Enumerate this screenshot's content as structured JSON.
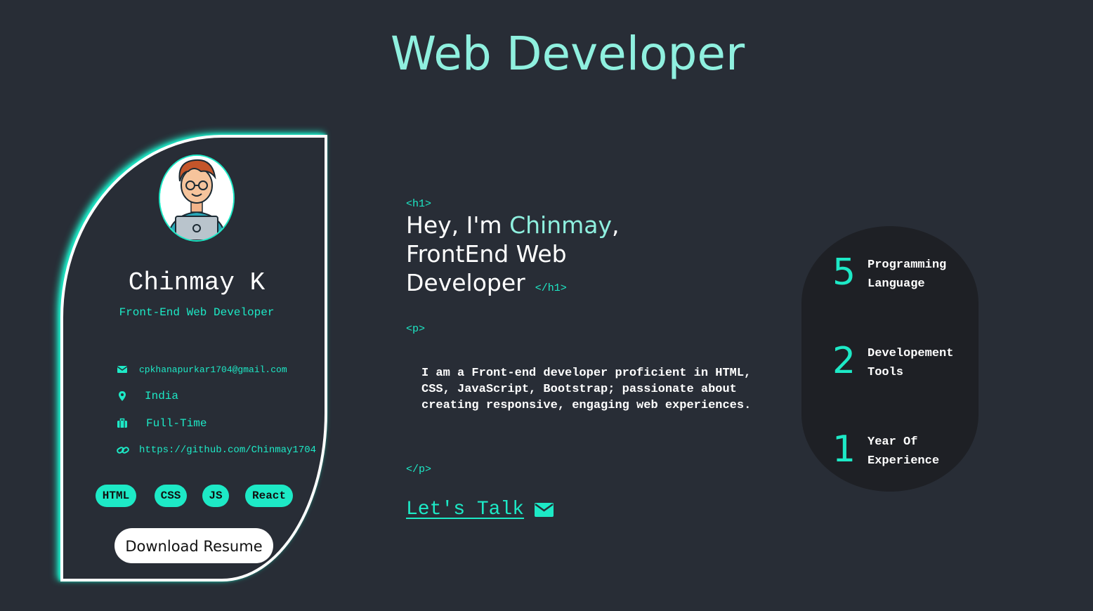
{
  "header": {
    "title": "Web Developer"
  },
  "profile": {
    "name": "Chinmay K",
    "role": "Front-End Web Developer",
    "email": "cpkhanapurkar1704@gmail.com",
    "location": "India",
    "job_type": "Full-Time",
    "github": "https://github.com/Chinmay1704",
    "skills": [
      "HTML",
      "CSS",
      "JS",
      "React"
    ],
    "download_label": "Download Resume"
  },
  "hero": {
    "open_h1": "<h1>",
    "greeting": "Hey, I'm ",
    "name": "Chinmay",
    "comma": ",",
    "line2": "FrontEnd Web",
    "line3": "Developer",
    "close_h1": "</h1>",
    "open_p": "<p>",
    "paragraph": "I am a Front-end developer proficient in HTML, CSS, JavaScript, Bootstrap; passionate about creating responsive, engaging web experiences.",
    "close_p": "</p>",
    "cta_label": "Let's Talk"
  },
  "stats": [
    {
      "value": "5",
      "label_line1": "Programming",
      "label_line2": "Language"
    },
    {
      "value": "2",
      "label_line1": "Developement",
      "label_line2": "Tools"
    },
    {
      "value": "1",
      "label_line1": "Year Of",
      "label_line2": "Experience"
    }
  ],
  "colors": {
    "background": "#282d36",
    "accent": "#1de9c6",
    "title": "#8ff0df",
    "stats_bg": "#1e2025"
  },
  "icons": [
    "envelope-icon",
    "map-pin-icon",
    "briefcase-icon",
    "link-icon",
    "mail-icon"
  ]
}
